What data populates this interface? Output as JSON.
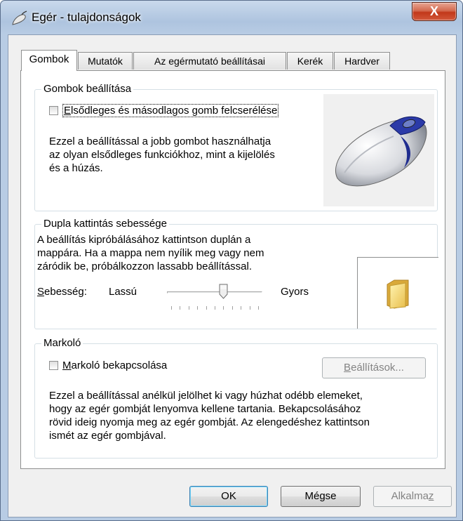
{
  "window": {
    "title": "Egér - tulajdonságok",
    "close_label": "X"
  },
  "tabs": [
    {
      "label": "Gombok"
    },
    {
      "label": "Mutatók"
    },
    {
      "label": "Az egérmutató beállításai"
    },
    {
      "label": "Kerék"
    },
    {
      "label": "Hardver"
    }
  ],
  "buttons_group": {
    "title": "Gombok beállítása",
    "checkbox_label_first": "E",
    "checkbox_label_rest": "lsődleges és másodlagos gomb felcserélése",
    "description": [
      "Ezzel a beállítással a jobb gombot használhatja",
      "az olyan elsődleges funkciókhoz, mint a kijelölés",
      "és a húzás."
    ]
  },
  "double_click_group": {
    "title": "Dupla kattintás sebessége",
    "description": [
      "A beállítás kipróbálásához kattintson duplán a",
      "mappára. Ha a mappa nem nyílik meg vagy nem",
      "záródik be, próbálkozzon lassabb beállítással."
    ],
    "speed_label_first": "S",
    "speed_label_rest": "ebesség:",
    "slow_label": "Lassú",
    "fast_label": "Gyors",
    "speed_fraction": 0.6
  },
  "clicklock_group": {
    "title": "Markoló",
    "checkbox_label_first": "M",
    "checkbox_label_rest": "arkoló bekapcsolása",
    "settings_button_first": "B",
    "settings_button_rest": "eállítások...",
    "description": [
      "Ezzel a beállítással anélkül jelölhet ki vagy húzhat odébb elemeket,",
      "hogy az egér gombját lenyomva kellene tartania.  Bekapcsolásához",
      "rövid ideig nyomja meg az egér gombját.  Az elengedéshez kattintson",
      "ismét az egér gombjával."
    ]
  },
  "footer": {
    "ok_label": "OK",
    "cancel_label": "Mégse",
    "apply_label_main": "Alkalma",
    "apply_label_underlined": "z"
  }
}
